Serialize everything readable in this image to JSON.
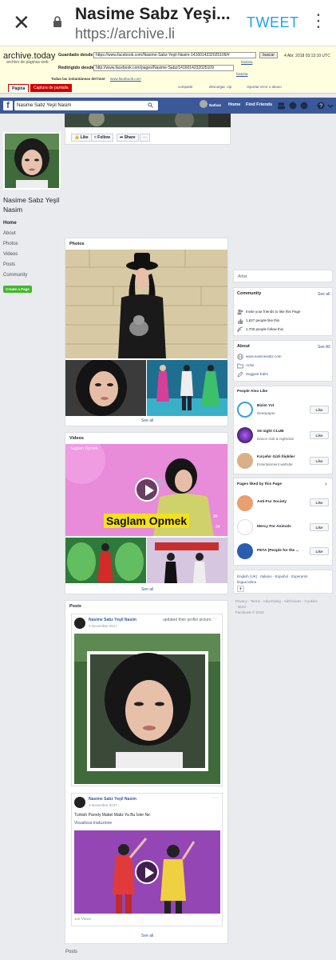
{
  "browser": {
    "close_icon": "close-icon",
    "title": "Nasime Sabz Yeşi...",
    "url": "https://archive.li",
    "tweet_label": "TWEET",
    "menu_icon": "more-vert-icon"
  },
  "archive": {
    "logo": "archive.today",
    "logo_sub": "archivo de páginas web",
    "saved_from_label": "Guardado desde",
    "saved_from_value": "https://www.facebook.com/Nasime-Sabz-Yeşil-Nasim-1416014232025109/#",
    "search_button": "buscar",
    "date": "4 Abr. 2018 03:13:10 UTC",
    "history_link_1": "historia",
    "redirected_label": "Redirigido desde",
    "redirected_value": "http://www.facebook.com/pages/Nasime-Sabz/1416014232025109",
    "history_link_2": "historia",
    "all_snapshots": "Todas las instantáneas del host",
    "host_link": "www.facebook.com",
    "share_link": "compartir",
    "download_link": "descargar .zip",
    "report_link": "reportar error o abuso",
    "tab_page": "Página",
    "tab_capture": "Captura de pantalla"
  },
  "fb_header": {
    "search_value": "Nasime Sabz Yeşil Nasim",
    "user_name": "Nathan",
    "nav_home": "Home",
    "nav_find_friends": "Find Friends"
  },
  "action_bar": {
    "like": "Like",
    "follow": "Follow",
    "share": "Share",
    "more": "···"
  },
  "left": {
    "page_name": "Nasime Sabz Yeşil Nasim",
    "nav": [
      "Home",
      "About",
      "Photos",
      "Videos",
      "Posts",
      "Community"
    ],
    "create_page": "Create a Page"
  },
  "photos": {
    "title": "Photos",
    "see_all": "See all"
  },
  "videos": {
    "title": "Videos",
    "overlay_title": "Saglam Opmek",
    "video_caption": "Saglam Opmek",
    "likes": "20",
    "comments": "34",
    "see_all": "See all"
  },
  "posts": {
    "title": "Posts",
    "post1": {
      "author": "Nasime Sabz Yeşil Nasim",
      "action": "updated their profile picture.",
      "date": "3 November 2017 · "
    },
    "post2": {
      "author": "Nasime Sabz Yeşil Nasim",
      "date": "3 November 2017 · ",
      "text": "Turkish Parody Mabel Matiz Ya Bu İsler Ne",
      "translate": "Visualizza traduzione",
      "views": "11K Views"
    },
    "see_all": "See all",
    "posts_footer": "Posts"
  },
  "right": {
    "category": "Artist",
    "community_title": "Community",
    "community_see_all": "See all",
    "invite": "Invite your friends to like this Page",
    "likes": "1,627 people like this",
    "follows": "1,700 people follow this",
    "about_title": "About",
    "about_see_all": "See All",
    "website": "www.nasimesabz.com",
    "about_category": "Artist",
    "suggest": "Suggest Edits",
    "pal_title": "People Also Like",
    "pal": [
      {
        "name": "Bizim Yol",
        "sub": "Newspaper",
        "like": "Like"
      },
      {
        "name": "X6 night CLUB",
        "sub": "Dance club & nightclub",
        "like": "Like"
      },
      {
        "name": "Kırçehir Gizli İlişkiler",
        "sub": "Entertainment website",
        "like": "Like"
      }
    ],
    "liked_title": "Pages liked by this Page",
    "liked": [
      {
        "name": "Anti-Fur Society",
        "like": "Like"
      },
      {
        "name": "Mercy For Animals",
        "like": "Like"
      },
      {
        "name": "PETA (People for the ...",
        "like": "Like"
      }
    ],
    "languages": "English (UK) · Italiano · Español · Esperanto",
    "languages2": "lingua latina",
    "footer_links": "Privacy · Terms · Advertising · AdChoices · Cookies",
    "footer_more": "· More ·",
    "copyright": "Facebook © 2018"
  }
}
